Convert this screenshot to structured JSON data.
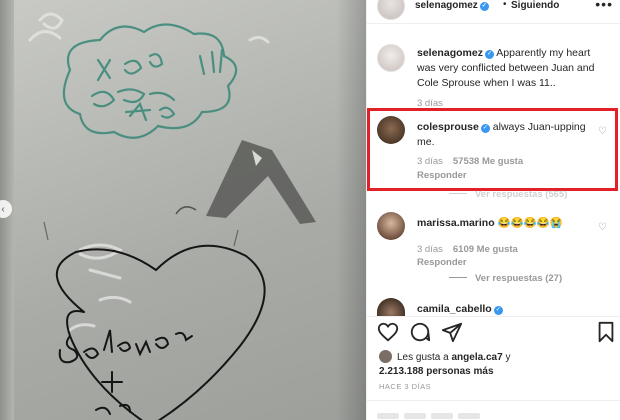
{
  "post": {
    "author": "selenagomez",
    "dot": "•",
    "follow_label": "Siguiendo",
    "more_icon": "more-icon"
  },
  "caption": {
    "user": "selenagomez",
    "text": "Apparently my heart was very conflicted between Juan and Cole Sprouse when I was 11..",
    "time": "3 días"
  },
  "comments": [
    {
      "user": "colesprouse",
      "text": "always Juan-upping me.",
      "time": "3 días",
      "likes": "57538 Me gusta",
      "reply": "Responder",
      "replies_label": "Ver respuestas (565)"
    },
    {
      "user": "marissa.marino",
      "text": "😂😂😂😂😭",
      "time": "3 días",
      "likes": "6109 Me gusta",
      "reply": "Responder",
      "replies_label": "Ver respuestas (27)"
    },
    {
      "user": "camila_cabello",
      "text": ""
    }
  ],
  "likes": {
    "prefix": "Les gusta a",
    "user": "angela.ca7",
    "conj": "y",
    "count": "2.213.188 personas más"
  },
  "time_ago": "HACE 3 DÍAS",
  "colors": {
    "verified": "#3897f0",
    "highlight": "#e2202a",
    "muted": "#999999"
  }
}
